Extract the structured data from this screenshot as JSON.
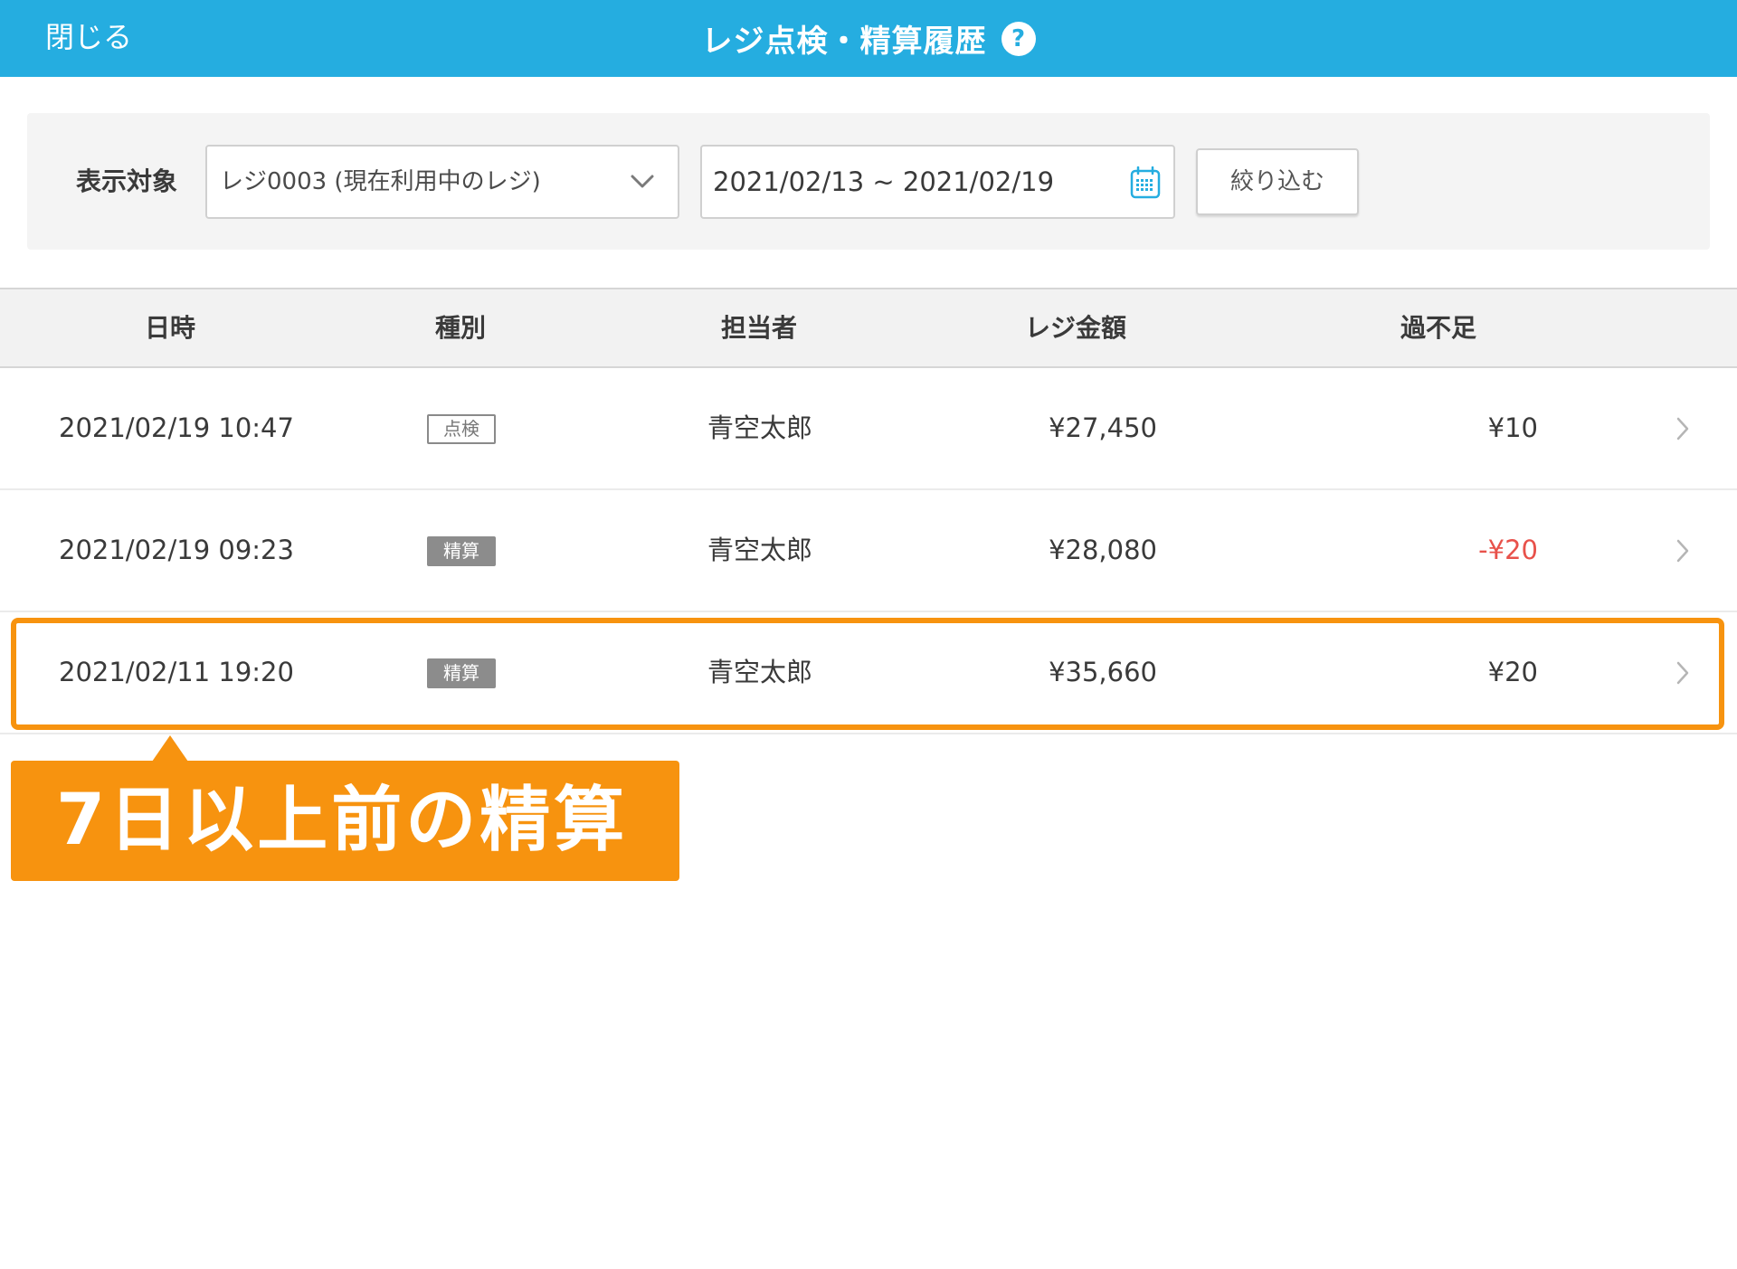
{
  "header": {
    "close_label": "閉じる",
    "title": "レジ点検・精算履歴",
    "help_glyph": "?"
  },
  "filter": {
    "label": "表示対象",
    "register_value": "レジ0003 (現在利用中のレジ)",
    "date_range": "2021/02/13 ~ 2021/02/19",
    "button_label": "絞り込む"
  },
  "table": {
    "columns": [
      "日時",
      "種別",
      "担当者",
      "レジ金額",
      "過不足"
    ],
    "rows": [
      {
        "datetime": "2021/02/19 10:47",
        "type": "点検",
        "staff": "青空太郎",
        "amount": "¥27,450",
        "diff": "¥10"
      },
      {
        "datetime": "2021/02/19 09:23",
        "type": "精算",
        "staff": "青空太郎",
        "amount": "¥28,080",
        "diff": "-¥20"
      },
      {
        "datetime": "2021/02/11 19:20",
        "type": "精算",
        "staff": "青空太郎",
        "amount": "¥35,660",
        "diff": "¥20"
      }
    ]
  },
  "callout": {
    "text": "7日以上前の精算"
  },
  "colors": {
    "header": "#25ade0",
    "accent_orange": "#f7930f",
    "negative": "#e8514a"
  },
  "icons": [
    "help-icon",
    "chevron-down-icon",
    "calendar-icon",
    "chevron-right-icon"
  ]
}
